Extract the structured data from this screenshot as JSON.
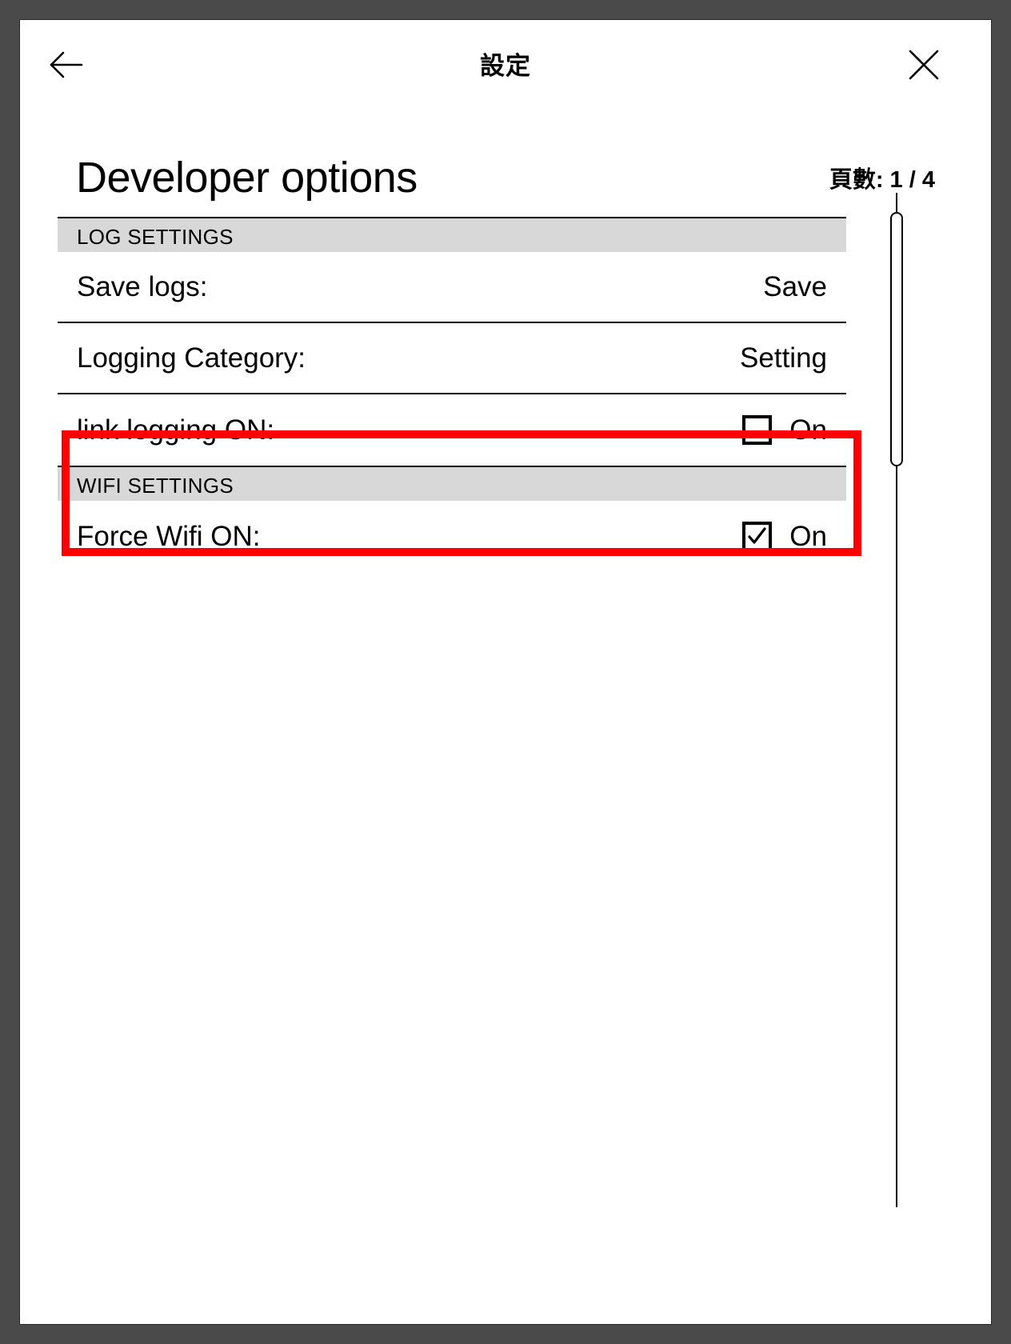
{
  "window": {
    "frame_color": "#4a4a4a",
    "background": "#ffffff"
  },
  "title_bar": {
    "back_icon": "arrow-left-icon",
    "title": "設定",
    "close_icon": "close-icon"
  },
  "page": {
    "title": "Developer options",
    "counter": "頁數: 1 / 4",
    "counter_label": "頁數:",
    "current_page": "1",
    "total_pages": "4"
  },
  "sections": [
    {
      "header": "LOG SETTINGS",
      "rows": [
        {
          "label": "Save logs:",
          "type": "action",
          "value": "Save"
        },
        {
          "label": "Logging Category:",
          "type": "action",
          "value": "Setting"
        },
        {
          "label": "link logging ON:",
          "type": "checkbox",
          "value": "On",
          "checked": false
        }
      ]
    },
    {
      "header": "WIFI SETTINGS",
      "highlighted": true,
      "rows": [
        {
          "label": "Force Wifi ON:",
          "type": "checkbox",
          "value": "On",
          "checked": true
        }
      ]
    }
  ],
  "highlight": {
    "color": "#ff0000",
    "target": "wifi-settings-section"
  },
  "scrollbar": {
    "orientation": "vertical",
    "position": "top"
  },
  "colors": {
    "section_header_bg": "#d8d8d8",
    "rule": "#000000",
    "text": "#000000",
    "highlight": "#ff0000"
  }
}
